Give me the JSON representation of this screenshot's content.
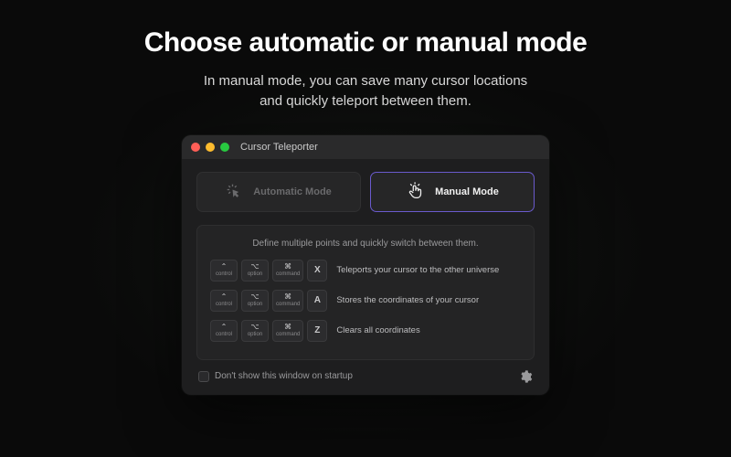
{
  "headline": "Choose automatic or manual mode",
  "subhead_line1": "In manual mode, you can save many cursor locations",
  "subhead_line2": "and quickly teleport between them.",
  "window": {
    "title": "Cursor Teleporter",
    "tabs": {
      "auto": "Automatic Mode",
      "manual": "Manual Mode"
    },
    "card_head": "Define multiple points and quickly switch between them.",
    "keys": {
      "control_sym": "⌃",
      "control_lbl": "control",
      "option_sym": "⌥",
      "option_lbl": "option",
      "command_sym": "⌘",
      "command_lbl": "command"
    },
    "shortcuts": [
      {
        "letter": "X",
        "desc": "Teleports your cursor to the other universe"
      },
      {
        "letter": "A",
        "desc": "Stores the coordinates of your cursor"
      },
      {
        "letter": "Z",
        "desc": "Clears all coordinates"
      }
    ],
    "footer_checkbox": "Don't show this window on startup"
  }
}
